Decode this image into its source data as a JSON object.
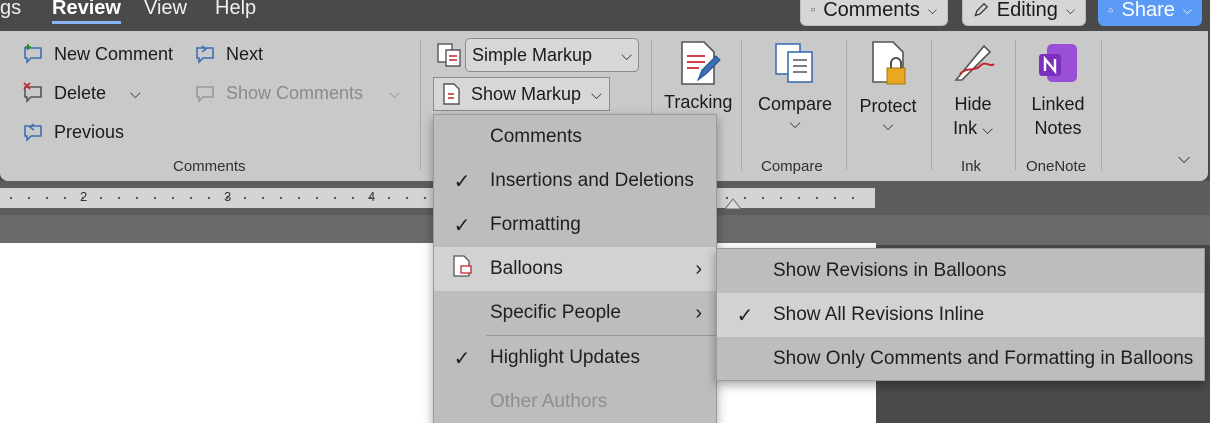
{
  "menubar": {
    "items": [
      "gs",
      "Review",
      "View",
      "Help"
    ],
    "active": "Review",
    "comments_label": "Comments",
    "editing_label": "Editing",
    "share_label": "Share"
  },
  "ribbon": {
    "comments_group": {
      "new_comment": "New Comment",
      "next": "Next",
      "delete": "Delete",
      "show_comments": "Show Comments",
      "previous": "Previous",
      "label": "Comments"
    },
    "markup": {
      "display_value": "Simple Markup",
      "show_markup": "Show Markup"
    },
    "tracking": {
      "label": "Tracking"
    },
    "compare": {
      "button": "Compare",
      "label": "Compare"
    },
    "protect": {
      "button": "Protect"
    },
    "ink": {
      "line1": "Hide",
      "line2": "Ink",
      "label": "Ink"
    },
    "onenote": {
      "line1": "Linked",
      "line2": "Notes",
      "label": "OneNote"
    }
  },
  "ruler": {
    "ticks": [
      "2",
      "3",
      "4"
    ]
  },
  "show_markup_menu": {
    "items": [
      {
        "label": "Comments",
        "underline": "C",
        "checked": false
      },
      {
        "label": "Insertions and Deletions",
        "underline": "I",
        "checked": true
      },
      {
        "label": "Formatting",
        "underline": "F",
        "checked": true
      },
      {
        "label": "Balloons",
        "underline": "B",
        "checked": false,
        "submenu": true
      },
      {
        "label": "Specific People",
        "underline": "S",
        "checked": false,
        "submenu": true
      },
      {
        "label": "Highlight Updates",
        "underline": "U",
        "checked": true
      },
      {
        "label": "Other Authors",
        "underline": "O",
        "checked": false,
        "disabled": true
      }
    ]
  },
  "balloons_submenu": {
    "items": [
      {
        "label": "Show Revisions in Balloons",
        "checked": false
      },
      {
        "label": "Show All Revisions Inline",
        "checked": true
      },
      {
        "label": "Show Only Comments and Formatting in Balloons",
        "checked": false
      }
    ]
  },
  "colors": {
    "ribbon_bg": "#c9c9c9",
    "menu_bg": "#bdbdbd",
    "menu_highlight": "#d2d2d2",
    "share_blue": "#5b9bf5",
    "onenote_purple": "#7b2fbf"
  }
}
